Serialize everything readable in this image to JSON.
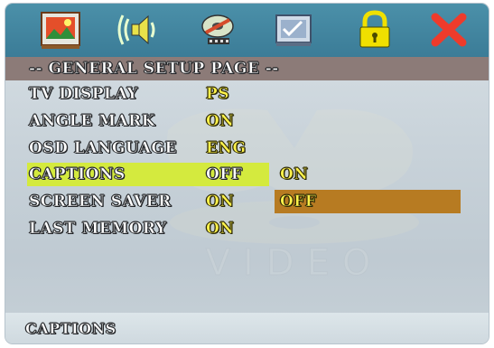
{
  "icon_bar": {
    "icons": [
      "general-setup-icon",
      "audio-setup-icon",
      "video-setup-icon",
      "preference-setup-icon",
      "password-lock-icon",
      "exit-icon"
    ],
    "colors": {
      "bar": "#3f819c",
      "lock": "#f0e000",
      "exit": "#ee3b2b"
    }
  },
  "page": {
    "title": "-- GENERAL SETUP PAGE --"
  },
  "menu": {
    "items": [
      {
        "label": "TV DISPLAY",
        "value": "PS"
      },
      {
        "label": "ANGLE MARK",
        "value": "ON"
      },
      {
        "label": "OSD LANGUAGE",
        "value": "ENG"
      },
      {
        "label": "CAPTIONS",
        "value": "OFF"
      },
      {
        "label": "SCREEN SAVER",
        "value": "ON"
      },
      {
        "label": "LAST MEMORY",
        "value": "ON"
      }
    ],
    "selected_index": 3
  },
  "submenu": {
    "options": [
      "ON",
      "OFF"
    ],
    "highlighted_index": 1
  },
  "background": {
    "watermark_text": "VIDEO"
  },
  "status": {
    "text": "CAPTIONS"
  },
  "colors": {
    "selected_row": "#d4ea3e",
    "highlighted_option": "#b77b22",
    "title_band": "#8c7b78",
    "value_text": "#fff24a"
  }
}
